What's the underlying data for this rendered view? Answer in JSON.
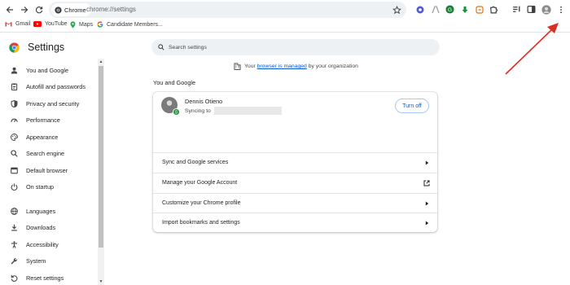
{
  "toolbar": {
    "chip_label": "Chrome",
    "url": "chrome://settings"
  },
  "bookmarks": [
    {
      "label": "Gmail",
      "icon": "gmail-icon"
    },
    {
      "label": "YouTube",
      "icon": "youtube-icon"
    },
    {
      "label": "Maps",
      "icon": "maps-icon"
    },
    {
      "label": "Candidate Members...",
      "icon": "google-icon"
    }
  ],
  "settings": {
    "title": "Settings",
    "search_placeholder": "Search settings",
    "managed_prefix": "Your ",
    "managed_link": "browser is managed",
    "managed_suffix": " by your organization",
    "section_title": "You and Google"
  },
  "sidebar": {
    "items": [
      {
        "label": "You and Google",
        "icon": "person-icon"
      },
      {
        "label": "Autofill and passwords",
        "icon": "clipboard-icon"
      },
      {
        "label": "Privacy and security",
        "icon": "shield-icon"
      },
      {
        "label": "Performance",
        "icon": "speedometer-icon"
      },
      {
        "label": "Appearance",
        "icon": "palette-icon"
      },
      {
        "label": "Search engine",
        "icon": "search-icon"
      },
      {
        "label": "Default browser",
        "icon": "browser-icon"
      },
      {
        "label": "On startup",
        "icon": "power-icon"
      },
      {
        "label": "Languages",
        "icon": "globe-icon"
      },
      {
        "label": "Downloads",
        "icon": "download-icon"
      },
      {
        "label": "Accessibility",
        "icon": "accessibility-icon"
      },
      {
        "label": "System",
        "icon": "wrench-icon"
      },
      {
        "label": "Reset settings",
        "icon": "reset-icon"
      }
    ]
  },
  "profile": {
    "name": "Dennis Otieno",
    "syncing_prefix": "Syncing to",
    "turn_off_label": "Turn off"
  },
  "card_rows": [
    {
      "label": "Sync and Google services",
      "action": "arrow"
    },
    {
      "label": "Manage your Google Account",
      "action": "external"
    },
    {
      "label": "Customize your Chrome profile",
      "action": "arrow"
    },
    {
      "label": "Import bookmarks and settings",
      "action": "arrow"
    }
  ],
  "colors": {
    "accent": "#0b57d0",
    "annotation_arrow": "#d93025",
    "sync_badge": "#1e8e3e"
  }
}
